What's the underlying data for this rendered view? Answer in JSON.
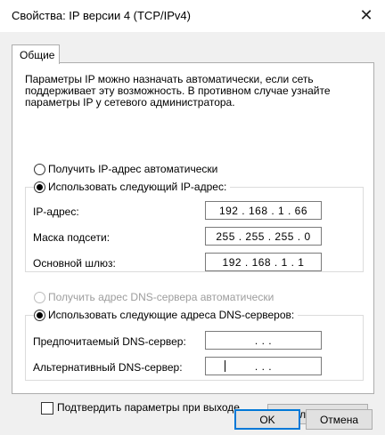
{
  "window": {
    "title": "Свойства: IP версии 4 (TCP/IPv4)",
    "close_glyph": "✕"
  },
  "tabs": [
    {
      "label": "Общие",
      "active": true
    }
  ],
  "description": "Параметры IP можно назначать автоматически, если сеть\nподдерживает эту возможность. В противном случае узнайте\nпараметры IP у сетевого администратора.",
  "ip": {
    "auto_label": "Получить IP-адрес автоматически",
    "manual_label": "Использовать следующий IP-адрес:",
    "selected": "manual",
    "fields": [
      {
        "label": "IP-адрес:",
        "value": "192 . 168 .  1  . 66"
      },
      {
        "label": "Маска подсети:",
        "value": "255 . 255 . 255 .  0"
      },
      {
        "label": "Основной шлюз:",
        "value": "192 . 168 .  1  .  1"
      }
    ]
  },
  "dns": {
    "auto_label": "Получить адрес DNS-сервера автоматически",
    "auto_disabled": true,
    "manual_label": "Использовать следующие адреса DNS-серверов:",
    "selected": "manual",
    "fields": [
      {
        "label": "Предпочитаемый DNS-сервер:",
        "value": ".       .       ."
      },
      {
        "label": "Альтернативный DNS-сервер:",
        "value": ".       .       ."
      }
    ]
  },
  "validate": {
    "label": "Подтвердить параметры при выходе",
    "checked": false
  },
  "buttons": {
    "advanced": "Дополнительно...",
    "ok": "OK",
    "cancel": "Отмена"
  },
  "colors": {
    "accent": "#0078d7",
    "panel_bg": "#ffffff",
    "dialog_bg": "#f0f0f0",
    "disabled_text": "#9d9d9d"
  }
}
